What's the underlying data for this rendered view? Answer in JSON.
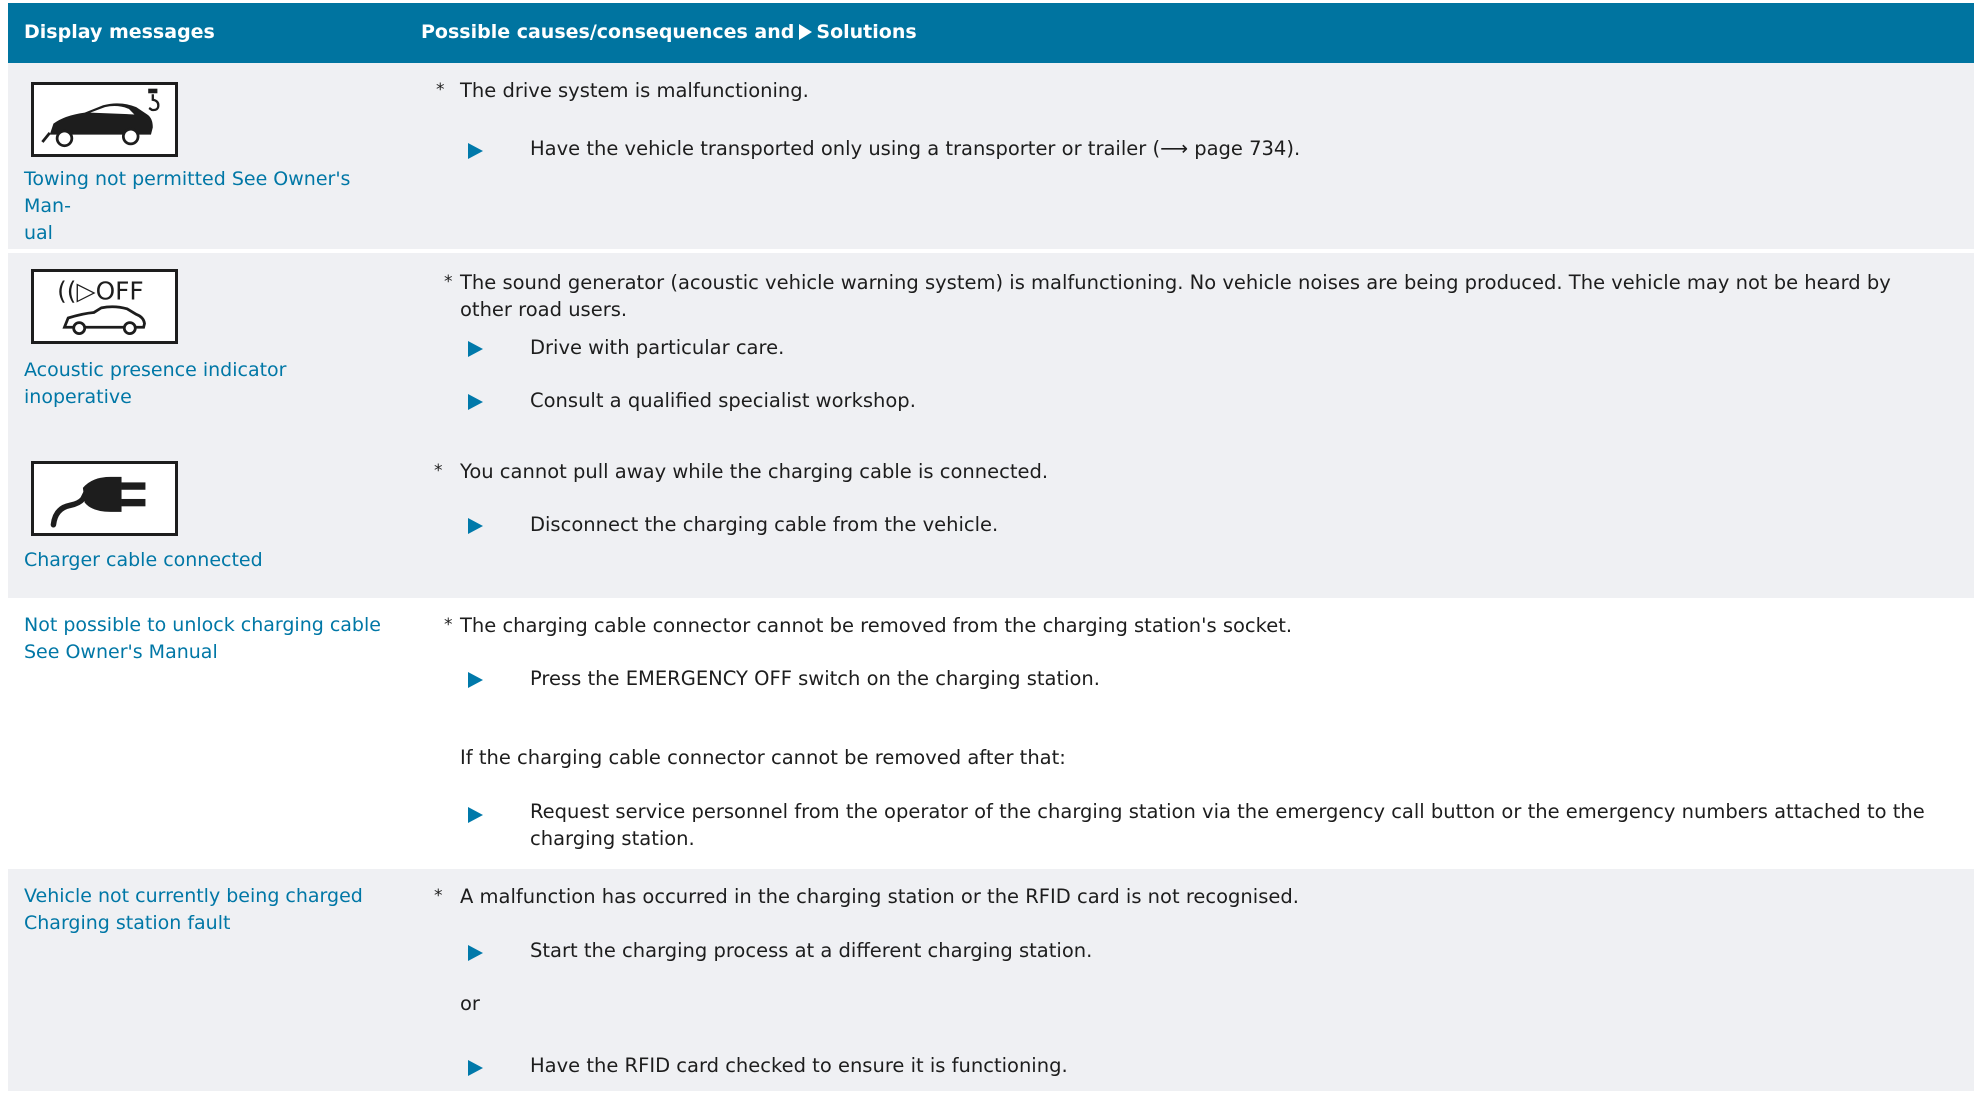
{
  "header": {
    "col1": "Display messages",
    "col2_prefix": "Possible causes/consequences and",
    "col2_suffix": "Solutions"
  },
  "rows": [
    {
      "icon": "tow-truck-car-icon",
      "message": "Towing not permitted See Owner's Man-ual",
      "message_line1": "Towing not permitted See Owner's Man-",
      "message_line2": "ual",
      "cause": "The drive system is malfunctioning.",
      "solutions": [
        "Have the vehicle transported only using a transporter or trailer (⟶ page 734)."
      ]
    },
    {
      "icon": "acoustic-off-car-icon",
      "icon_text": "((▷OFF",
      "message": "Acoustic presence indicator inoperative",
      "cause": "The sound generator (acoustic vehicle warning system) is malfunctioning. No vehicle noises are being produced. The vehicle may not be heard by other road users.",
      "solutions": [
        "Drive with particular care.",
        "Consult a qualified specialist workshop."
      ]
    },
    {
      "icon": "charging-plug-icon",
      "message": "Charger cable connected",
      "cause": "You cannot pull away while the charging cable is connected.",
      "solutions": [
        "Disconnect the charging cable from the vehicle."
      ]
    },
    {
      "message_line1": "Not possible to unlock charging cable",
      "message_line2": "See Owner's Manual",
      "cause": "The charging cable connector cannot be removed from the charging station's socket.",
      "solutions": [
        "Press the EMERGENCY OFF switch on the charging station."
      ],
      "note": "If the charging cable connector cannot be removed after that:",
      "solutions2": [
        "Request service personnel from the operator of the charging station via the emergency call button or the emergency numbers attached to the charging station."
      ]
    },
    {
      "message_line1": "Vehicle not currently being charged",
      "message_line2": "Charging station fault",
      "cause": "A malfunction has occurred in the charging station or the RFID card is not recognised.",
      "solutions": [
        "Start the charging process at a different charging station."
      ],
      "or": "or",
      "solutions2": [
        "Have the RFID card checked to ensure it is functioning."
      ]
    }
  ],
  "star": "*",
  "colors": {
    "header": "#0074a0",
    "shade": "#eff0f3",
    "message": "#0077a6",
    "solution_triangle": "#0079aa"
  }
}
